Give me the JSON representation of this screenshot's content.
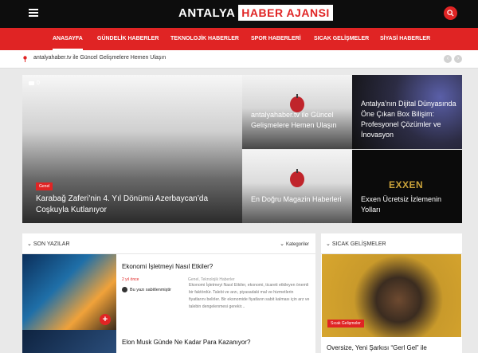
{
  "header": {
    "logo_part1": "ANTALYA",
    "logo_part2": "HABER AJANSI"
  },
  "nav": {
    "items": [
      "ANASAYFA",
      "GÜNDELİK HABERLER",
      "TEKNOLOJİK HABERLER",
      "SPOR HABERLERİ",
      "SICAK GELİŞMELER",
      "SİYASİ HABERLER"
    ]
  },
  "ticker": {
    "text": "antalyahaber.tv ile Güncel Gelişmelere Hemen Ulaşın",
    "prev": "‹",
    "next": "›"
  },
  "hero": {
    "main": {
      "comments": "0",
      "badge": "Genel",
      "title": "Karabağ Zaferi’nin 4. Yıl Dönümü Azerbaycan’da Coşkuyla Kutlanıyor"
    },
    "tiles": [
      {
        "title": "antalyahaber.tv ile Güncel Gelişmelere Hemen Ulaşın"
      },
      {
        "title": "Antalya’nın Dijital Dünyasında Öne Çıkan Box Bilişim: Profesyonel Çözümler ve İnovasyon"
      },
      {
        "title": "En Doğru Magazin Haberleri"
      },
      {
        "title": "Exxen Ücretsiz İzlemenin Yolları",
        "logo": "EXXEN"
      }
    ]
  },
  "son_yazilar": {
    "heading": "SON YAZILAR",
    "categories_label": "Kategoriler",
    "articles": [
      {
        "title": "Ekonomi İşletmeyi Nasıl Etkiler?",
        "time": "2 yıl önce",
        "category": "Genel, Teknolojik Haberler",
        "author": "Bu yazı sabitlenmiştir",
        "excerpt": "Ekonomi İşletmeyi Nasıl Etkiler, ekonomi, ticareti etkileyen önemli bir faktördür. Talebi ve arzı, piyasadaki mal ve hizmetlerin fiyatlarını belirler. Bir ekonomide fiyatların sabit kalması için arz ve talebin dengelenmesi gerekir...",
        "plus": "+"
      },
      {
        "title": "Elon Musk Günde Ne Kadar Para Kazanıyor?"
      }
    ]
  },
  "sicak": {
    "heading": "SICAK GELİŞMELER",
    "badge": "Sıcak Gelişmeler",
    "title": "Oversize, Yeni Şarkısı “Gerl Gel” ile"
  },
  "colors": {
    "brand_red": "#e02424",
    "header_black": "#0d0d0d"
  }
}
